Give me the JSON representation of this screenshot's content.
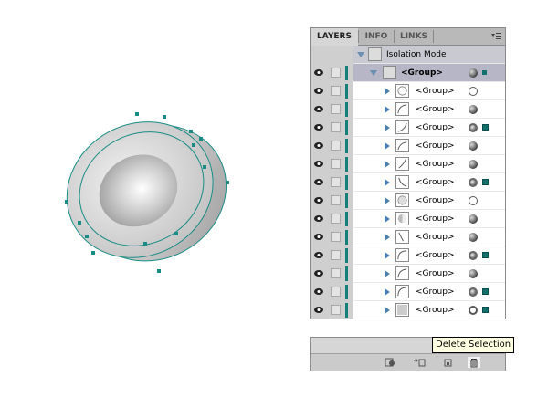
{
  "panel": {
    "tabs": [
      {
        "label": "LAYERS",
        "active": true
      },
      {
        "label": "INFO",
        "active": false
      },
      {
        "label": "LINKS",
        "active": false
      }
    ],
    "menu_icon": "panel-menu-icon",
    "isolation_label": "Isolation Mode",
    "group_label": "<Group>",
    "rows": [
      {
        "label": "<Group>",
        "target": "empty",
        "selected": false
      },
      {
        "label": "<Group>",
        "target": "filled",
        "selected": false
      },
      {
        "label": "<Group>",
        "target": "ring",
        "selected": true
      },
      {
        "label": "<Group>",
        "target": "filled",
        "selected": false
      },
      {
        "label": "<Group>",
        "target": "filled",
        "selected": false
      },
      {
        "label": "<Group>",
        "target": "ring",
        "selected": true
      },
      {
        "label": "<Group>",
        "target": "empty",
        "selected": false
      },
      {
        "label": "<Group>",
        "target": "filled",
        "selected": false
      },
      {
        "label": "<Group>",
        "target": "filled",
        "selected": false
      },
      {
        "label": "<Group>",
        "target": "ring",
        "selected": true
      },
      {
        "label": "<Group>",
        "target": "filled",
        "selected": false
      },
      {
        "label": "<Group>",
        "target": "ring",
        "selected": true
      },
      {
        "label": "<Group>",
        "target": "ringw",
        "selected": true
      }
    ]
  },
  "bottom_bar": {
    "icons": [
      "make-clipping-mask-icon",
      "create-sublayer-icon",
      "create-new-layer-icon",
      "delete-selection-icon"
    ]
  },
  "tooltip": "Delete Selection",
  "colors": {
    "selection": "#14807a",
    "panel_bg": "#d6d6d6",
    "tab_bg": "#b9b9b9",
    "group_row": "#b6b6c6"
  }
}
